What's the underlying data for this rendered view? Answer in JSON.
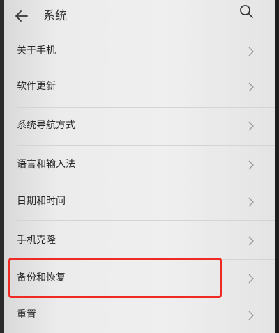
{
  "header": {
    "title": "系统"
  },
  "icons": {
    "back": "arrow-left-icon",
    "search": "search-icon",
    "chevron": "chevron-right-icon"
  },
  "colors": {
    "highlight_border": "#f02a22"
  },
  "menu": {
    "items": [
      {
        "label": "关于手机"
      },
      {
        "label": "软件更新"
      },
      {
        "label": "系统导航方式"
      },
      {
        "label": "语言和输入法"
      },
      {
        "label": "日期和时间"
      },
      {
        "label": "手机克隆"
      },
      {
        "label": "备份和恢复"
      },
      {
        "label": "重置"
      }
    ]
  }
}
